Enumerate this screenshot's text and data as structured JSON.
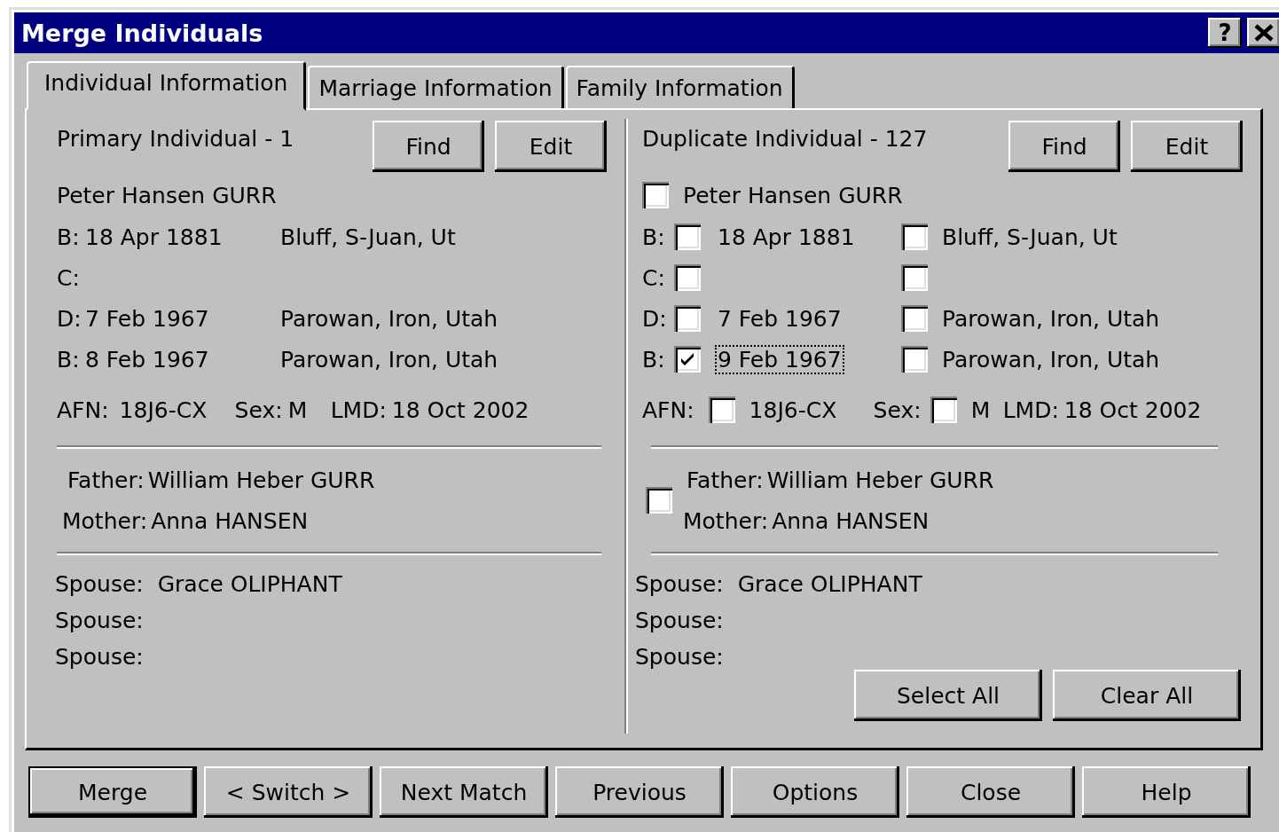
{
  "window": {
    "title": "Merge Individuals",
    "help_glyph": "?"
  },
  "tabs": [
    {
      "label": "Individual Information",
      "selected": true
    },
    {
      "label": "Marriage Information",
      "selected": false
    },
    {
      "label": "Family Information",
      "selected": false
    }
  ],
  "primary": {
    "heading": "Primary Individual - 1",
    "buttons": [
      "Find",
      "Edit"
    ],
    "name": "Peter Hansen GURR",
    "events": [
      {
        "label": "B:",
        "date": "18 Apr 1881",
        "place": "Bluff, S-Juan, Ut"
      },
      {
        "label": "C:"
      },
      {
        "label": "D:",
        "date": "7 Feb 1967",
        "place": "Parowan, Iron, Utah"
      },
      {
        "label": "B:",
        "date": "8 Feb 1967",
        "place": "Parowan, Iron, Utah"
      }
    ],
    "afn_label": "AFN:",
    "afn": "18J6-CX",
    "sex_label": "Sex:",
    "sex": "M",
    "lmd_label": "LMD:",
    "lmd": "18 Oct 2002",
    "father_label": "Father:",
    "father": "William Heber GURR",
    "mother_label": "Mother:",
    "mother": "Anna HANSEN",
    "spouses": [
      {
        "label": "Spouse:",
        "name": "Grace OLIPHANT"
      },
      {
        "label": "Spouse:"
      },
      {
        "label": "Spouse:"
      }
    ]
  },
  "duplicate": {
    "heading": "Duplicate Individual - 127",
    "buttons": [
      "Find",
      "Edit"
    ],
    "name": "Peter Hansen GURR",
    "name_checked": false,
    "events": [
      {
        "label": "B:",
        "date": "18 Apr 1881",
        "date_checked": false,
        "date_focused": false,
        "place": "Bluff, S-Juan, Ut",
        "place_checked": false
      },
      {
        "label": "C:",
        "date_checked": false,
        "date_focused": false,
        "place_checked": false
      },
      {
        "label": "D:",
        "date": "7 Feb 1967",
        "date_checked": false,
        "date_focused": false,
        "place": "Parowan, Iron, Utah",
        "place_checked": false
      },
      {
        "label": "B:",
        "date": "9 Feb 1967",
        "date_checked": true,
        "date_focused": true,
        "place": "Parowan, Iron, Utah",
        "place_checked": false
      }
    ],
    "afn_label": "AFN:",
    "afn": "18J6-CX",
    "afn_checked": false,
    "sex_label": "Sex:",
    "sex": "M",
    "sex_checked": false,
    "lmd_label": "LMD:",
    "lmd": "18 Oct 2002",
    "parents_checked": false,
    "father_label": "Father:",
    "father": "William Heber GURR",
    "mother_label": "Mother:",
    "mother": "Anna HANSEN",
    "spouses": [
      {
        "label": "Spouse:",
        "name": "Grace OLIPHANT"
      },
      {
        "label": "Spouse:"
      },
      {
        "label": "Spouse:"
      }
    ],
    "selection_buttons": [
      "Select All",
      "Clear All"
    ]
  },
  "buttons": [
    {
      "label": "Merge",
      "default": true
    },
    {
      "label": "< Switch >",
      "default": false
    },
    {
      "label": "Next Match",
      "default": false
    },
    {
      "label": "Previous",
      "default": false
    },
    {
      "label": "Options",
      "default": false
    },
    {
      "label": "Close",
      "default": false
    },
    {
      "label": "Help",
      "default": false
    }
  ]
}
